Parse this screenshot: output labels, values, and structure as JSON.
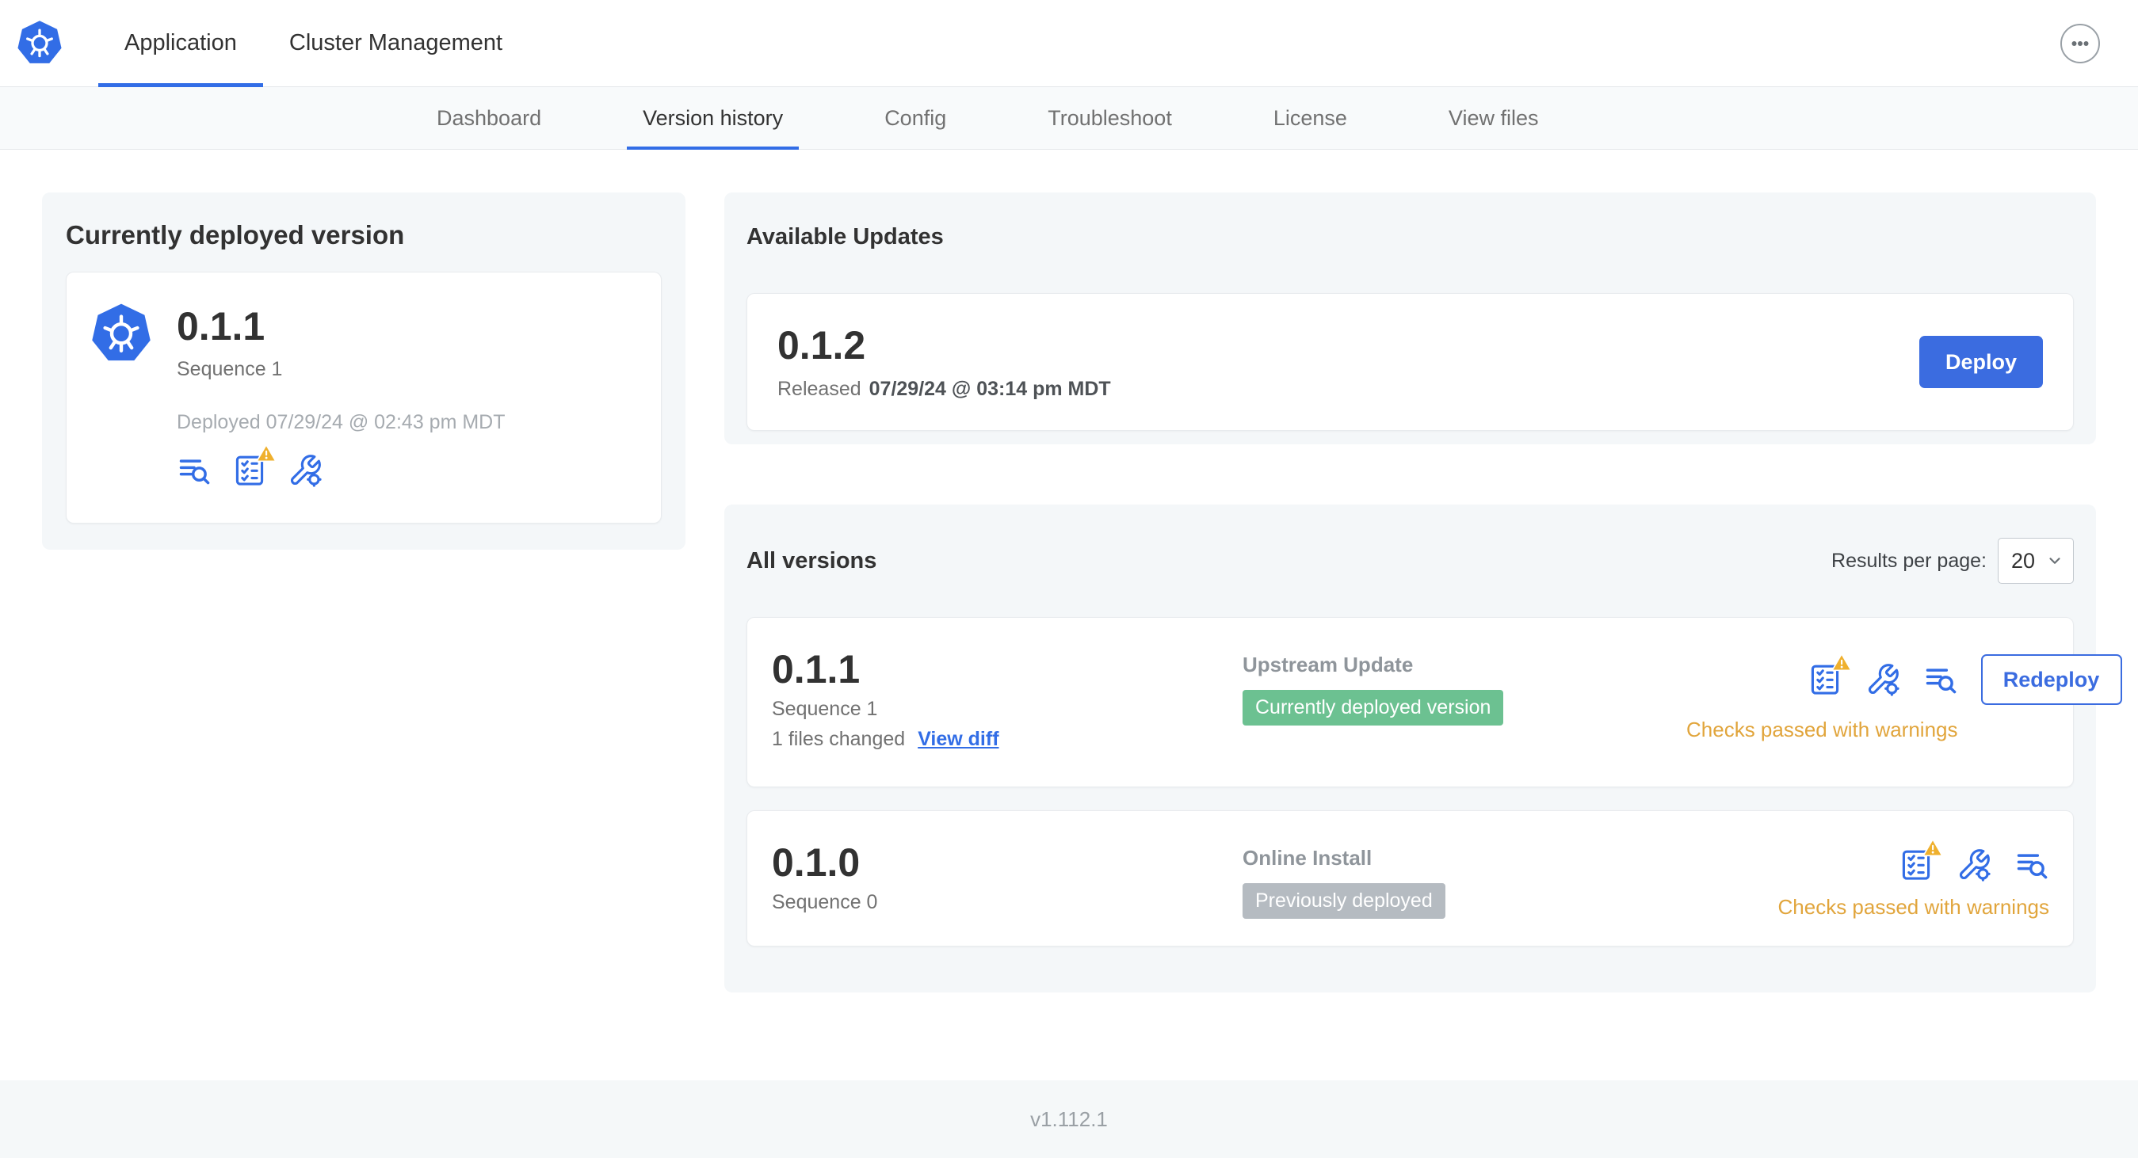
{
  "header": {
    "tabs": [
      {
        "label": "Application",
        "active": true
      },
      {
        "label": "Cluster Management",
        "active": false
      }
    ]
  },
  "subnav": {
    "items": [
      {
        "label": "Dashboard",
        "active": false
      },
      {
        "label": "Version history",
        "active": true
      },
      {
        "label": "Config",
        "active": false
      },
      {
        "label": "Troubleshoot",
        "active": false
      },
      {
        "label": "License",
        "active": false
      },
      {
        "label": "View files",
        "active": false
      }
    ]
  },
  "current_version_card": {
    "title": "Currently deployed version",
    "version": "0.1.1",
    "sequence": "Sequence 1",
    "deployed_text": "Deployed 07/29/24 @ 02:43 pm MDT"
  },
  "available_updates": {
    "title": "Available Updates",
    "version": "0.1.2",
    "released_label": "Released",
    "released_date": "07/29/24 @ 03:14 pm MDT",
    "deploy_button": "Deploy"
  },
  "all_versions": {
    "title": "All versions",
    "results_per_page_label": "Results per page:",
    "results_per_page_value": "20",
    "rows": [
      {
        "version": "0.1.1",
        "sequence": "Sequence 1",
        "files_changed": "1 files changed",
        "view_diff_link": "View diff",
        "source_type": "Upstream Update",
        "status_badge": "Currently deployed version",
        "badge_color": "#6cc191",
        "checks_text": "Checks passed with warnings",
        "redeploy_button": "Redeploy"
      },
      {
        "version": "0.1.0",
        "sequence": "Sequence 0",
        "source_type": "Online Install",
        "status_badge": "Previously deployed",
        "badge_color": "#b5bbc1",
        "checks_text": "Checks passed with warnings"
      }
    ]
  },
  "footer": {
    "app_version": "v1.112.1"
  },
  "colors": {
    "accent_blue": "#326de6",
    "button_blue": "#3b6ce0",
    "warning_orange": "#e1a53c",
    "success_badge_green": "#6cc191",
    "neutral_badge_gray": "#b5bbc1",
    "card_background": "#f4f7f9"
  },
  "icons": {
    "app_logo": "kubernetes-helm-wheel",
    "more_menu": "ellipsis-in-circle",
    "view_logs": "lines-with-magnifier",
    "preflight_checks": "checklist",
    "config_tools": "wrench-with-gear",
    "warning": "yellow-warning-triangle",
    "dropdown": "chevron-down"
  }
}
